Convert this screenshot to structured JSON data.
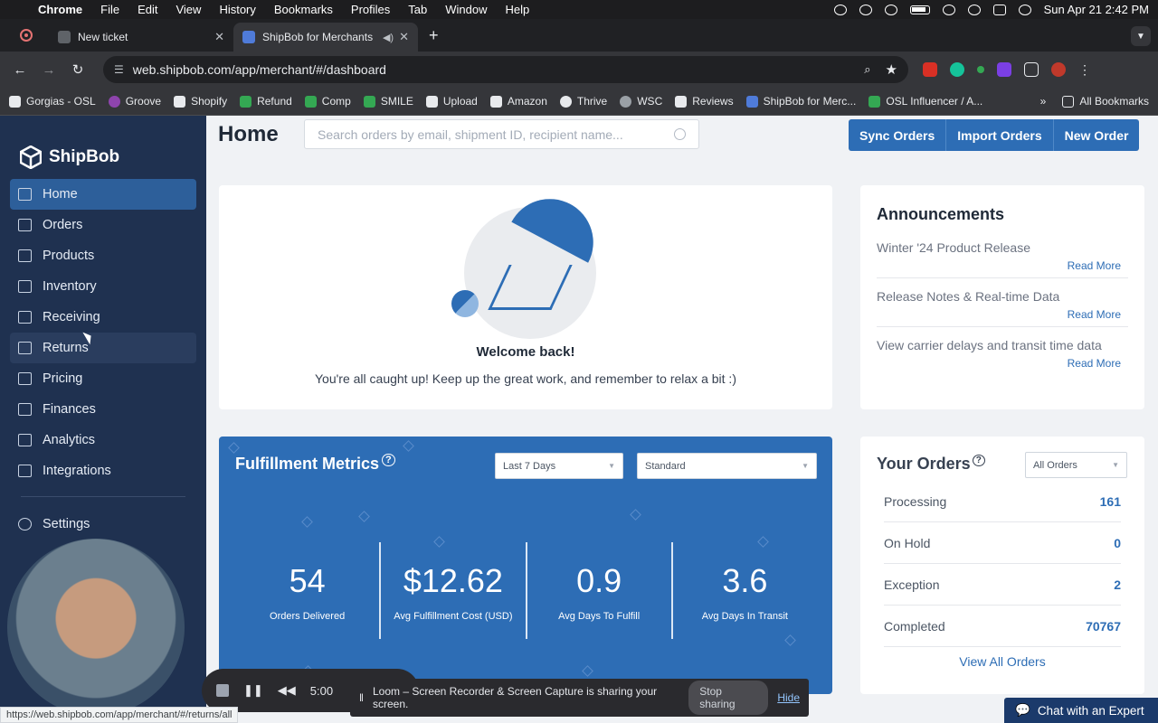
{
  "mac_menubar": {
    "app": "Chrome",
    "menus": [
      "File",
      "Edit",
      "View",
      "History",
      "Bookmarks",
      "Profiles",
      "Tab",
      "Window",
      "Help"
    ],
    "clock": "Sun Apr 21  2:42 PM"
  },
  "browser": {
    "tabs": [
      {
        "title": "New ticket",
        "active": false
      },
      {
        "title": "ShipBob for Merchants",
        "active": true
      }
    ],
    "new_tab_label": "+",
    "url": "web.shipbob.com/app/merchant/#/dashboard",
    "extension_badge": "2",
    "bookmarks": [
      "Gorgias - OSL",
      "Groove",
      "Shopify",
      "Refund",
      "Comp",
      "SMILE",
      "Upload",
      "Amazon",
      "Thrive",
      "WSC",
      "Reviews",
      "ShipBob for Merc...",
      "OSL Influencer / A..."
    ],
    "more_bookmarks": "»",
    "all_bookmarks": "All Bookmarks",
    "status_url": "https://web.shipbob.com/app/merchant/#/returns/all"
  },
  "sidebar": {
    "brand": "ShipBob",
    "items": [
      {
        "label": "Home",
        "icon": "home-icon",
        "state": "active"
      },
      {
        "label": "Orders",
        "icon": "bag-icon",
        "state": ""
      },
      {
        "label": "Products",
        "icon": "product-icon",
        "state": ""
      },
      {
        "label": "Inventory",
        "icon": "inventory-icon",
        "state": ""
      },
      {
        "label": "Receiving",
        "icon": "receiving-icon",
        "state": ""
      },
      {
        "label": "Returns",
        "icon": "returns-icon",
        "state": "hover"
      },
      {
        "label": "Pricing",
        "icon": "pricing-icon",
        "state": ""
      },
      {
        "label": "Finances",
        "icon": "finances-icon",
        "state": ""
      },
      {
        "label": "Analytics",
        "icon": "analytics-icon",
        "state": ""
      },
      {
        "label": "Integrations",
        "icon": "integrations-icon",
        "state": ""
      }
    ],
    "settings_label": "Settings"
  },
  "header": {
    "title": "Home",
    "search_placeholder": "Search orders by email, shipment ID, recipient name...",
    "buttons": [
      "Sync Orders",
      "Import Orders",
      "New Order"
    ]
  },
  "welcome": {
    "heading": "Welcome back!",
    "message": "You're all caught up! Keep up the great work, and remember to relax a bit :)"
  },
  "announcements": {
    "title": "Announcements",
    "items": [
      {
        "title": "Winter '24 Product Release",
        "link": "Read More"
      },
      {
        "title": "Release Notes & Real-time Data",
        "link": "Read More"
      },
      {
        "title": "View carrier delays and transit time data",
        "link": "Read More"
      }
    ]
  },
  "metrics": {
    "title": "Fulfillment Metrics",
    "help": "?",
    "range_select": "Last 7 Days",
    "service_select": "Standard",
    "kpis": [
      {
        "value": "54",
        "label": "Orders Delivered"
      },
      {
        "value": "$12.62",
        "label": "Avg Fulfillment Cost (USD)"
      },
      {
        "value": "0.9",
        "label": "Avg Days To Fulfill"
      },
      {
        "value": "3.6",
        "label": "Avg Days In Transit"
      }
    ]
  },
  "orders": {
    "title": "Your Orders",
    "help": "?",
    "filter": "All Orders",
    "rows": [
      {
        "label": "Processing",
        "count": "161"
      },
      {
        "label": "On Hold",
        "count": "0"
      },
      {
        "label": "Exception",
        "count": "2"
      },
      {
        "label": "Completed",
        "count": "70767"
      }
    ],
    "view_all": "View All Orders"
  },
  "loom": {
    "timer": "5:00",
    "message": "Loom – Screen Recorder & Screen Capture is sharing your screen.",
    "stop_label": "Stop sharing",
    "hide_label": "Hide"
  },
  "chat_label": "Chat with an Expert",
  "colors": {
    "sidebar": "#1f3150",
    "accent": "#2d6db5",
    "active_nav": "#2d5f9a"
  }
}
